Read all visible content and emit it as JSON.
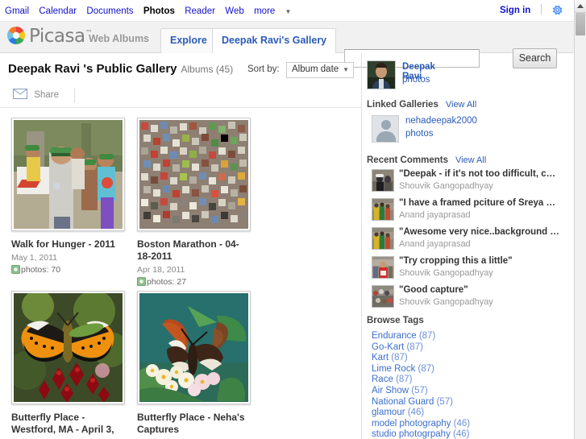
{
  "gbar": {
    "links": [
      {
        "label": "Gmail",
        "current": false
      },
      {
        "label": "Calendar",
        "current": false
      },
      {
        "label": "Documents",
        "current": false
      },
      {
        "label": "Photos",
        "current": true
      },
      {
        "label": "Reader",
        "current": false
      },
      {
        "label": "Web",
        "current": false
      }
    ],
    "more_label": "more",
    "sign_in": "Sign in",
    "gear_icon": "gear-icon"
  },
  "header": {
    "wordmark": "Picasa",
    "tm": "™",
    "product": "Web Albums",
    "logo_icon": "picasa-pinwheel-logo",
    "tabs": [
      {
        "label": "Explore",
        "active": false
      },
      {
        "label": "Deepak Ravi's Gallery",
        "active": true
      }
    ],
    "search": {
      "value": "",
      "placeholder": "",
      "button": "Search",
      "icon": "search-icon"
    }
  },
  "gallery": {
    "name": "Deepak Ravi 's Public Gallery",
    "count_label": "Albums (45)",
    "sort_label": "Sort by:",
    "sort_value": "Album date",
    "share_label": "Share",
    "share_icon": "envelope-icon"
  },
  "albums": [
    {
      "title": "Walk for Hunger - 2011",
      "date": "May 1, 2011",
      "photos_label": "photos: 70",
      "visibility_icon": "public-globe-icon",
      "thumb": "crowd-walkers-green-visors"
    },
    {
      "title": "Boston Marathon - 04-18-2011",
      "date": "Apr 18, 2011",
      "photos_label": "photos: 27",
      "visibility_icon": "public-globe-icon",
      "thumb": "dense-marathon-crowd"
    },
    {
      "title": "Butterfly Place - Westford, MA - April 3,",
      "date": "",
      "photos_label": "",
      "visibility_icon": "public-globe-icon",
      "thumb": "orange-butterfly-red-flowers"
    },
    {
      "title": "Butterfly Place - Neha's Captures",
      "date": "",
      "photos_label": "",
      "visibility_icon": "public-globe-icon",
      "thumb": "brown-butterfly-pale-flowers"
    }
  ],
  "sidebar": {
    "owner": {
      "name": "Deepak Ravi",
      "photos_link": "photos",
      "avatar": "owner-portrait"
    },
    "linked": {
      "heading": "Linked Galleries",
      "view_all": "View All",
      "items": [
        {
          "name": "nehadeepak2000",
          "photos_link": "photos",
          "avatar": "default-person-avatar"
        }
      ]
    },
    "comments": {
      "heading": "Recent Comments",
      "view_all": "View All",
      "items": [
        {
          "text": "\"Deepak - if it's not too difficult, could you e-ma...",
          "author": "Shouvik Gangopadhyay",
          "thumb": "marathon-runner-dark"
        },
        {
          "text": "\"I have a framed pciture of Sreya standing and ...",
          "author": "Anand jayaprasad",
          "thumb": "runners-green-yellow"
        },
        {
          "text": "\"Awesome very nice..background Bokeh and s...",
          "author": "Anand jayaprasad",
          "thumb": "runners-green-yellow"
        },
        {
          "text": "\"Try cropping this a little\"",
          "author": "Shouvik Gangopadhyay",
          "thumb": "runner-red-shirt"
        },
        {
          "text": "\"Good capture\"",
          "author": "Shouvik Gangopadhyay",
          "thumb": "crowd-spectators"
        }
      ]
    },
    "tags": {
      "heading": "Browse Tags",
      "items": [
        {
          "name": "Endurance",
          "count": "(87)"
        },
        {
          "name": "Go-Kart",
          "count": "(87)"
        },
        {
          "name": "Kart",
          "count": "(87)"
        },
        {
          "name": "Lime Rock",
          "count": "(87)"
        },
        {
          "name": "Race",
          "count": "(87)"
        },
        {
          "name": "Air Show",
          "count": "(57)"
        },
        {
          "name": "National Guard",
          "count": "(57)"
        },
        {
          "name": "glamour",
          "count": "(46)"
        },
        {
          "name": "model photography",
          "count": "(46)"
        },
        {
          "name": "studio photogrpahy",
          "count": "(46)"
        }
      ]
    }
  },
  "scrollbar": {
    "up_icon": "scroll-up-arrow"
  },
  "colors": {
    "link": "#1111cc",
    "tab_blue": "#2b5bb7",
    "tag_blue": "#3b6ecc",
    "accent": "#4d90fe"
  }
}
